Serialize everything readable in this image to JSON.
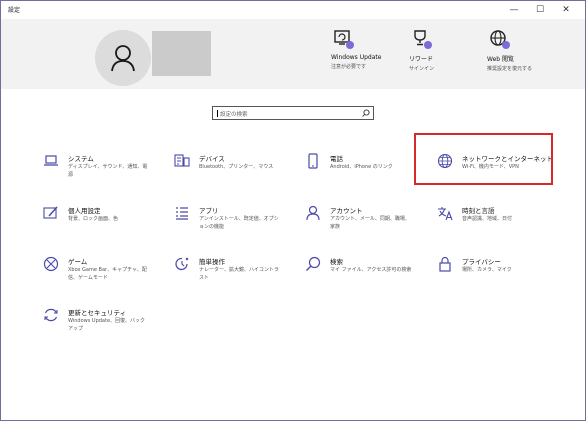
{
  "window": {
    "title": "設定",
    "minimize": "—",
    "maximize": "☐",
    "close": "✕"
  },
  "header": {
    "quick_links": [
      {
        "title": "Windows Update",
        "subtitle": "注意が必要です"
      },
      {
        "title": "リワード",
        "subtitle": "サインイン"
      },
      {
        "title": "Web 閲覧",
        "subtitle": "推奨設定を復元する"
      }
    ]
  },
  "search": {
    "placeholder": "設定の検索"
  },
  "tiles": [
    {
      "title": "システム",
      "desc": "ディスプレイ、サウンド、通知、電源"
    },
    {
      "title": "デバイス",
      "desc": "Bluetooth、プリンター、マウス"
    },
    {
      "title": "電話",
      "desc": "Android、iPhone のリンク"
    },
    {
      "title": "ネットワークとインターネット",
      "desc": "Wi-Fi、機内モード、VPN"
    },
    {
      "title": "個人用設定",
      "desc": "背景、ロック画面、色"
    },
    {
      "title": "アプリ",
      "desc": "アンインストール、既定値、オプションの機能"
    },
    {
      "title": "アカウント",
      "desc": "アカウント、メール、同期、職場、家族"
    },
    {
      "title": "時刻と言語",
      "desc": "音声認識、地域、日付"
    },
    {
      "title": "ゲーム",
      "desc": "Xbox Game Bar、キャプチャ、配信、ゲームモード"
    },
    {
      "title": "簡単操作",
      "desc": "ナレーター、拡大鏡、ハイコントラスト"
    },
    {
      "title": "検索",
      "desc": "マイ ファイル、アクセス許可の検索"
    },
    {
      "title": "プライバシー",
      "desc": "場所、カメラ、マイク"
    },
    {
      "title": "更新とセキュリティ",
      "desc": "Windows Update、回復、バックアップ"
    }
  ],
  "colors": {
    "accent": "#7b6cd6",
    "icon": "#4a4aa8",
    "highlight": "#d42a2a",
    "header_bg": "#f2f2f2"
  }
}
